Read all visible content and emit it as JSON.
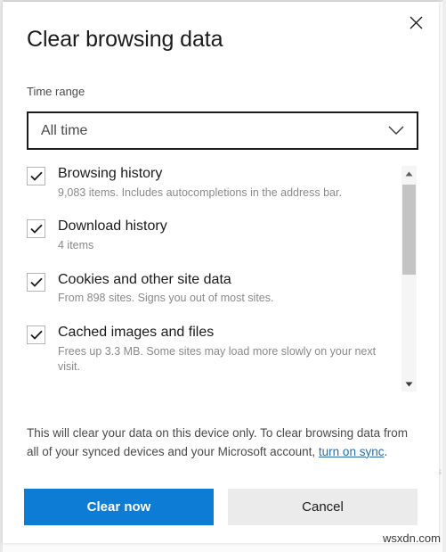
{
  "dialog": {
    "title": "Clear browsing data",
    "close_icon": "close-icon"
  },
  "time_range": {
    "label": "Time range",
    "selected": "All time",
    "chevron_icon": "chevron-down-icon",
    "options": [
      "All time"
    ]
  },
  "items": [
    {
      "title": "Browsing history",
      "description": "9,083 items. Includes autocompletions in the address bar.",
      "checked": true
    },
    {
      "title": "Download history",
      "description": "4 items",
      "checked": true
    },
    {
      "title": "Cookies and other site data",
      "description": "From 898 sites. Signs you out of most sites.",
      "checked": true
    },
    {
      "title": "Cached images and files",
      "description": "Frees up 3.3 MB. Some sites may load more slowly on your next visit.",
      "checked": true
    }
  ],
  "scrollbar": {
    "up_arrow_icon": "scroll-up-arrow-icon",
    "down_arrow_icon": "scroll-down-arrow-icon"
  },
  "footer": {
    "text_before": "This will clear your data on this device only. To clear browsing data from all of your synced devices and your Microsoft account, ",
    "link_text": "turn on sync",
    "text_after": "."
  },
  "actions": {
    "primary_label": "Clear now",
    "secondary_label": "Cancel"
  },
  "overlay": {
    "watermark": "wsxdn.com",
    "ghost_side": "s"
  },
  "colors": {
    "accent": "#0c7cd5",
    "secondary_button": "#ebebeb",
    "link": "#2d6da3",
    "title_text": "#1b1b1b",
    "muted_text": "#8a8a8a",
    "scrollbar_thumb": "#c4c4c4"
  }
}
